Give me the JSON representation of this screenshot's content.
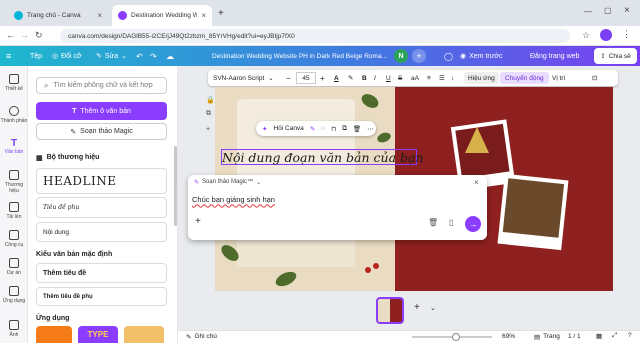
{
  "browser": {
    "tabs": [
      {
        "label": "Trang chủ - Canva"
      },
      {
        "label": "Destination Wedding Website P"
      }
    ],
    "url": "canva.com/design/DAGlB55-i2CE/jJ49Qt2zbzm_85YrVHg/edit?ui=eyJBIjp7fX0"
  },
  "toolbar": {
    "home": "Tệp",
    "resize": "Đổi cỡ",
    "edit": "Sửa",
    "title": "Destination Wedding Website PH in Dark Red Beige Roma...",
    "avatar": "N",
    "plus": "+",
    "preview": "Xem trước",
    "publish": "Đăng trang web",
    "share": "Chia sẻ"
  },
  "rail": [
    {
      "label": "Thiết kế"
    },
    {
      "label": "Thành phần"
    },
    {
      "label": "Văn bản"
    },
    {
      "label": "Thương hiệu"
    },
    {
      "label": "Tải lên"
    },
    {
      "label": "Công cụ"
    },
    {
      "label": "Dự án"
    },
    {
      "label": "Ứng dụng"
    },
    {
      "label": "Ảnh"
    }
  ],
  "panel": {
    "search_placeholder": "Tìm kiếm phông chữ và kết hợp",
    "add_text": "Thêm ô văn bản",
    "magic_write": "Soạn thảo Magic",
    "brand_kit": "Bộ thương hiệu",
    "headline": "HEADLINE",
    "subheading": "Tiêu đề phụ",
    "body": "Nội dung",
    "default_styles": "Kiểu văn bản mặc định",
    "add_heading": "Thêm tiêu đề",
    "add_subheading": "Thêm tiêu đề phụ",
    "apps": "Ứng dụng",
    "app_thumb": "TYPE"
  },
  "contextbar": {
    "font": "SVN-Aaron Script",
    "size": "45",
    "minus": "−",
    "plus": "+",
    "effects": "Hiệu ứng",
    "animate": "Chuyển động",
    "position": "Vị trí"
  },
  "canvas": {
    "text": "Nội dung đoạn văn bản của bạn",
    "canva_ai": "Hỏi Canva"
  },
  "dialog": {
    "title": "Soạn thảo Magic™",
    "input": "Chúc bạn giáng sinh hạn"
  },
  "bottom": {
    "notes": "Ghi chú",
    "zoom": "69%",
    "pages_label": "Trang",
    "page_count": "1 / 1"
  },
  "colors": {
    "purple": "#8b3dff",
    "teal": "#1fb8cd",
    "darkred": "#8e2020",
    "beige": "#e9dcc2"
  }
}
